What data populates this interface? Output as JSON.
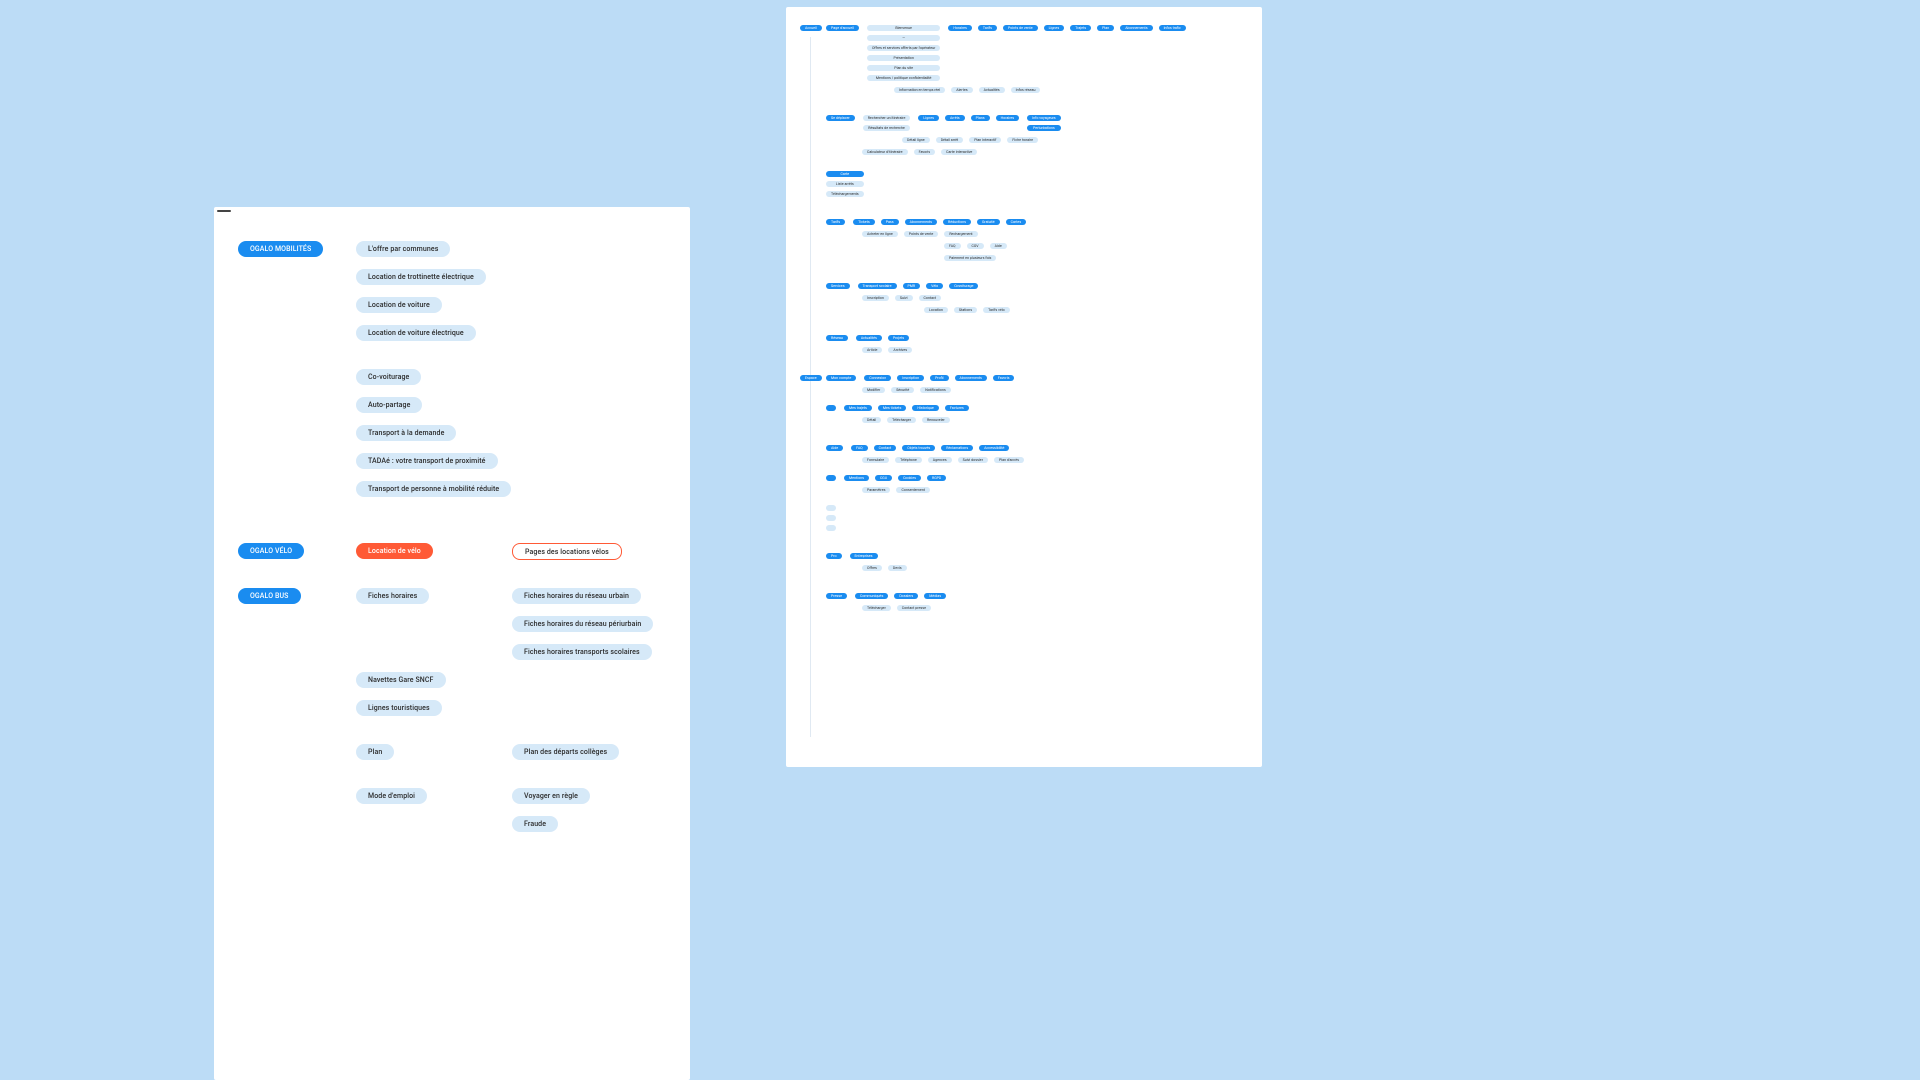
{
  "left": {
    "section_mobilites": {
      "root": "OGALO MOBILITÉS",
      "items": [
        "L'offre par communes",
        "Location de trottinette électrique",
        "Location de voiture",
        "Location de voiture électrique",
        "Co-voiturage",
        "Auto-partage",
        "Transport à la demande",
        "TADAé : votre transport de proximité",
        "Transport de personne à mobilité réduite"
      ]
    },
    "section_velo": {
      "root": "OGALO VÉLO",
      "item_red": "Location de  vélo",
      "item_outline": "Pages des locations vélos"
    },
    "section_bus": {
      "root": "OGALO BUS",
      "fiches": "Fiches horaires",
      "fiches_children": [
        "Fiches horaires du réseau urbain",
        "Fiches horaires du réseau périurbain",
        "Fiches horaires transports scolaires"
      ],
      "navettes": "Navettes Gare SNCF",
      "lignes": "Lignes touristiques",
      "plan": "Plan",
      "plan_child": "Plan des départs collèges",
      "mode": "Mode d'emploi",
      "mode_children": [
        "Voyager en règle",
        "Fraude"
      ]
    }
  },
  "right": {
    "g1": {
      "lead": "Accueil",
      "a": "Page d'accueil",
      "col2": [
        "Bienvenue",
        "—",
        "Offres et services offerts par l'opérateur",
        "Présentation",
        "Plan du site",
        "Mentions / politique confidentialité"
      ],
      "rest": [
        "Horaires",
        "Tarifs",
        "Points de vente",
        "Lignes",
        "Trajets",
        "Plan",
        "Abonnements",
        "Infos trafic"
      ],
      "sub": [
        "Information en temps réel",
        "Alertes",
        "Actualités",
        "Infos réseau"
      ]
    },
    "g2": {
      "a": "Se déplacer",
      "col2": [
        "Rechercher un itinéraire",
        "Résultats de recherche"
      ],
      "row2": [
        "Lignes",
        "Arrêts",
        "Plans",
        "Horaires"
      ],
      "row2b": [
        "Détail ligne",
        "Détail arrêt",
        "Plan interactif",
        "Fiche horaire"
      ],
      "sub": [
        "Calculateur d'itinéraire",
        "Favoris",
        "Carte interactive"
      ],
      "x": [
        "Carte",
        "Liste arrêts",
        "Téléchargements"
      ],
      "tail": [
        "Info voyageurs",
        "Perturbations"
      ]
    },
    "g3": {
      "a": "Tarifs",
      "row": [
        "Tickets",
        "Pass",
        "Abonnements",
        "Réductions",
        "Gratuité",
        "Cartes"
      ],
      "sub": [
        "Acheter en ligne",
        "Points de vente",
        "Rechargement"
      ],
      "mid": [
        "FAQ",
        "CGV",
        "Aide"
      ],
      "last": "Paiement en plusieurs fois"
    },
    "g4": {
      "a": "Services",
      "row": [
        "Transport scolaire",
        "PMR",
        "Vélo",
        "Covoiturage"
      ],
      "sub": [
        "Inscription",
        "Suivi",
        "Contact"
      ],
      "mid": [
        "Location",
        "Stations",
        "Tarifs vélo"
      ]
    },
    "g5": {
      "a": "Réseau",
      "row": [
        "Actualités",
        "Projets"
      ],
      "sub": [
        "Article",
        "Archives"
      ]
    },
    "g6": {
      "lead": "Espace",
      "a": "Mon compte",
      "row": [
        "Connexion",
        "Inscription",
        "Profil",
        "Abonnements",
        "Favoris"
      ],
      "sub": [
        "Modifier",
        "Sécurité",
        "Notifications"
      ],
      "row2": [
        "Mes trajets",
        "Mes tickets",
        "Historique",
        "Factures"
      ],
      "sub2": [
        "Détail",
        "Télécharger",
        "Renouveler"
      ]
    },
    "g7": {
      "a": "Aide",
      "row": [
        "FAQ",
        "Contact",
        "Objets trouvés",
        "Réclamations",
        "Accessibilité"
      ],
      "sub": [
        "Formulaire",
        "Téléphone",
        "Agences",
        "Suivi dossier",
        "Plan d'accès"
      ],
      "row2": [
        "Mentions",
        "CGU",
        "Cookies",
        "RGPD"
      ],
      "sub2": [
        "Paramètres",
        "Consentement"
      ]
    },
    "g8": {
      "a": "Pro",
      "row": [
        "Entreprises"
      ],
      "sub": [
        "Offres",
        "Devis"
      ]
    },
    "g9": {
      "a": "Presse",
      "row": [
        "Communiqués",
        "Dossiers",
        "Médias"
      ],
      "sub": [
        "Télécharger",
        "Contact presse"
      ]
    }
  }
}
